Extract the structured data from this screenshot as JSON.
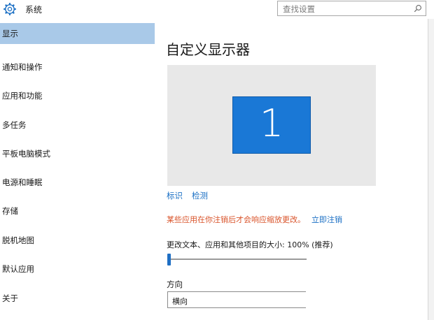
{
  "app": {
    "title": "系统"
  },
  "search": {
    "placeholder": "查找设置"
  },
  "sidebar": {
    "items": [
      {
        "label": "显示",
        "active": true
      },
      {
        "label": "通知和操作"
      },
      {
        "label": "应用和功能"
      },
      {
        "label": "多任务"
      },
      {
        "label": "平板电脑模式"
      },
      {
        "label": "电源和睡眠"
      },
      {
        "label": "存储"
      },
      {
        "label": "脱机地图"
      },
      {
        "label": "默认应用"
      },
      {
        "label": "关于"
      }
    ]
  },
  "main": {
    "title": "自定义显示器",
    "monitor_number": "1",
    "identify_link": "标识",
    "detect_link": "检测",
    "warning": "某些应用在你注销后才会响应缩放更改。",
    "signout_link": "立即注销",
    "scale_label": "更改文本、应用和其他项目的大小: 100% (推荐)",
    "scale_percent": 100,
    "orientation_label": "方向",
    "orientation_value": "横向"
  },
  "colors": {
    "accent": "#1a78d6",
    "active_nav": "#a9c9e8",
    "link": "#1a6fc4",
    "warning": "#d9532a"
  }
}
